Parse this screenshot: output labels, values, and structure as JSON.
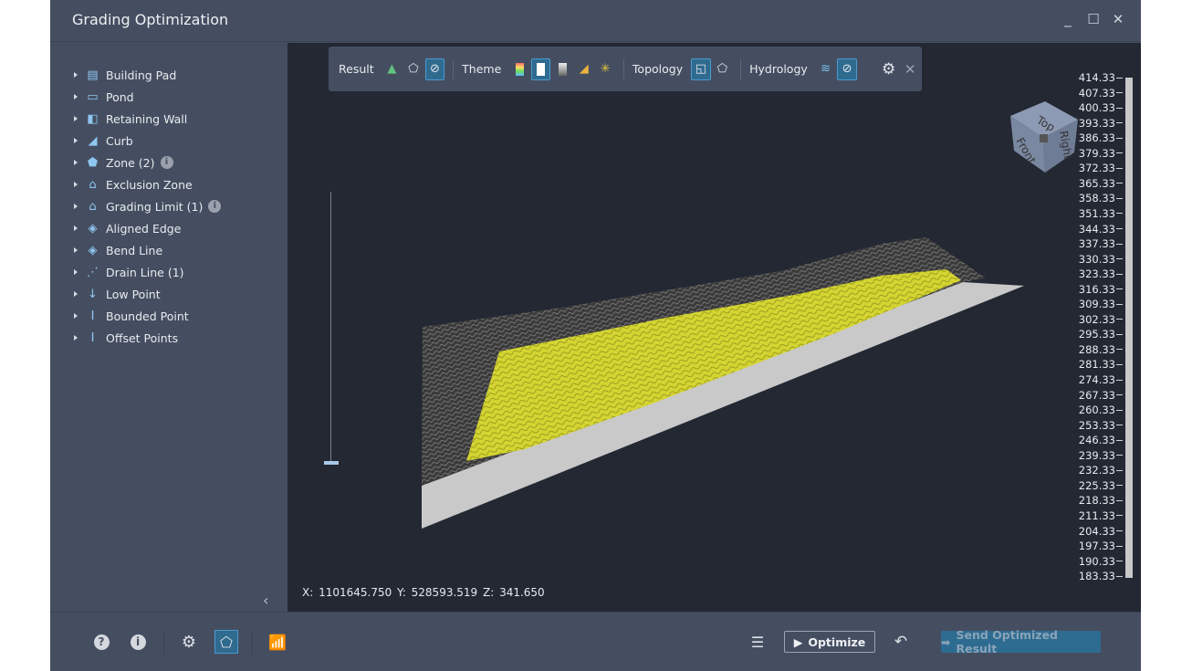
{
  "window": {
    "title": "Grading Optimization",
    "icons": [
      "minimize-icon",
      "maximize-icon",
      "close-icon"
    ]
  },
  "sidebar": {
    "items": [
      {
        "label": "Building Pad",
        "icon": "building-pad-icon",
        "glyph": "▤"
      },
      {
        "label": "Pond",
        "icon": "pond-icon",
        "glyph": "▭"
      },
      {
        "label": "Retaining Wall",
        "icon": "retaining-wall-icon",
        "glyph": "◧"
      },
      {
        "label": "Curb",
        "icon": "curb-icon",
        "glyph": "◢"
      },
      {
        "label": "Zone (2)",
        "icon": "zone-icon",
        "glyph": "⬟",
        "info": true
      },
      {
        "label": "Exclusion Zone",
        "icon": "exclusion-zone-icon",
        "glyph": "⌂"
      },
      {
        "label": "Grading Limit (1)",
        "icon": "grading-limit-icon",
        "glyph": "⌂",
        "info": true
      },
      {
        "label": "Aligned Edge",
        "icon": "aligned-edge-icon",
        "glyph": "◈"
      },
      {
        "label": "Bend Line",
        "icon": "bend-line-icon",
        "glyph": "◈"
      },
      {
        "label": "Drain Line (1)",
        "icon": "drain-line-icon",
        "glyph": "⋰"
      },
      {
        "label": "Low Point",
        "icon": "low-point-icon",
        "glyph": "↓"
      },
      {
        "label": "Bounded Point",
        "icon": "bounded-point-icon",
        "glyph": "I"
      },
      {
        "label": "Offset Points",
        "icon": "offset-points-icon",
        "glyph": "I"
      }
    ]
  },
  "toolbar": {
    "result_label": "Result",
    "theme_label": "Theme",
    "topology_label": "Topology",
    "hydrology_label": "Hydrology"
  },
  "viewport": {
    "coords": "X: 1101645.750   Y: 528593.519   Z: 341.650",
    "scale_labels": [
      "414.33",
      "407.33",
      "400.33",
      "393.33",
      "386.33",
      "379.33",
      "372.33",
      "365.33",
      "358.33",
      "351.33",
      "344.33",
      "337.33",
      "330.33",
      "323.33",
      "316.33",
      "309.33",
      "302.33",
      "295.33",
      "288.33",
      "281.33",
      "274.33",
      "267.33",
      "260.33",
      "253.33",
      "246.33",
      "239.33",
      "232.33",
      "225.33",
      "218.33",
      "211.33",
      "204.33",
      "197.33",
      "190.33",
      "183.33"
    ],
    "viewcube": {
      "top": "Top",
      "front": "Front",
      "right": "Right"
    },
    "colors": {
      "selection": "#d8d834",
      "terrain": "#3a3a3a",
      "base": "#c9c9c9"
    }
  },
  "bottom": {
    "optimize_label": "Optimize",
    "send_label": "Send Optimized Result"
  }
}
